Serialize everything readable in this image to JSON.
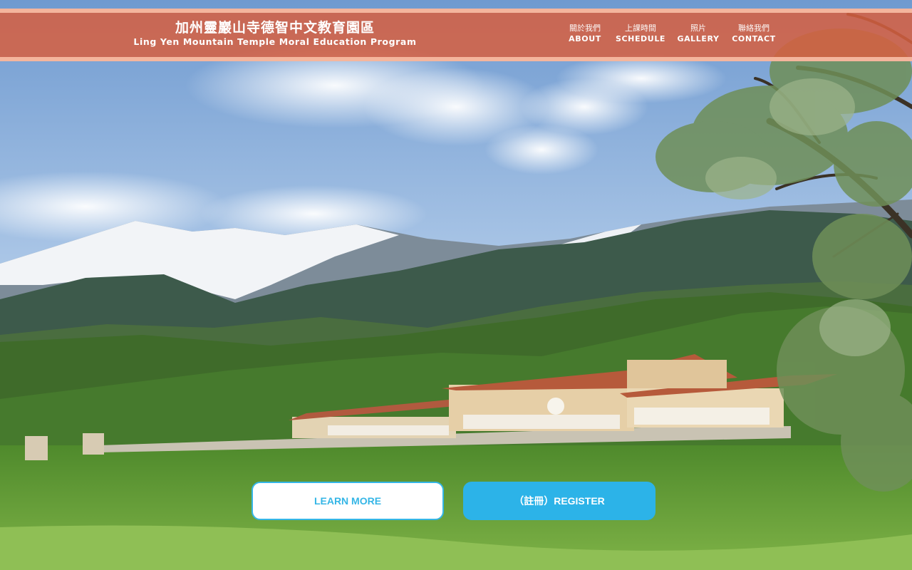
{
  "brand": {
    "title_cn": "加州靈巖山寺德智中文教育園區",
    "title_en": "Ling Yen Mountain Temple Moral Education Program"
  },
  "nav": {
    "items": [
      {
        "label_cn": "關於我們",
        "label_en": "ABOUT"
      },
      {
        "label_cn": "上課時間",
        "label_en": "SCHEDULE"
      },
      {
        "label_cn": "照片",
        "label_en": "GALLERY"
      },
      {
        "label_cn": "聯絡我們",
        "label_en": "CONTACT"
      }
    ]
  },
  "hero": {
    "learn_more_label": "LEARN MORE",
    "register_label": "（註冊）REGISTER"
  },
  "colors": {
    "header_bg": "#d66040",
    "header_border": "#f8bea5",
    "accent_blue": "#2cb3e8"
  }
}
